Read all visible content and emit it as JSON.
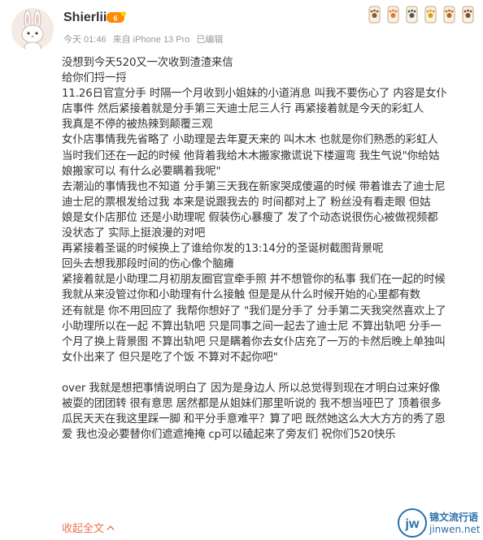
{
  "header": {
    "username": "Shierlii",
    "meta": {
      "time": "今天 01:46",
      "source": "来自 iPhone 13 Pro",
      "edited": "已编辑"
    },
    "vip_icon": "vip-badge-icon",
    "badge_icons": [
      "paw-badge-icon",
      "paw-badge-icon",
      "paw-badge-icon",
      "paw-badge-icon",
      "paw-badge-icon",
      "paw-badge-icon"
    ]
  },
  "post": {
    "lines": [
      "没想到今天520又一次收到渣渣来信",
      "给你们捋一捋",
      "11.26日官宣分手 时隔一个月收到小姐妹的小道消息 叫我不要伤心了 内容是女仆",
      "店事件 然后紧接着就是分手第三天迪士尼三人行 再紧接着就是今天的彩虹人",
      "我真是不停的被热辣到颠覆三观",
      "女仆店事情我先省略了 小助理是去年夏天来的 叫木木 也就是你们熟悉的彩虹人",
      "当时我们还在一起的时候 他背着我给木木搬家撒谎说下楼遛弯 我生气说\"你给姑",
      "娘搬家可以 有什么必要瞒着我呢\"",
      "去潮汕的事情我也不知道 分手第三天我在新家哭成傻逼的时候 带着谁去了迪士尼",
      " 迪士尼的票根发给过我 本来是说跟我去的 时间都对上了 粉丝没有看走眼 但姑",
      "娘是女仆店那位 还是小助理呢 假装伤心暴瘦了 发了个动态说很伤心被做视频都",
      "没状态了 实际上挺浪漫的对吧",
      "再紧接着圣诞的时候换上了谁给你发的13:14分的圣诞树截图背景呢",
      "回头去想我那段时间的伤心像个脑瘫",
      "紧接着就是小助理二月初朋友圈官宣牵手照 并不想管你的私事 我们在一起的时候",
      "我就从来没管过你和小助理有什么接触 但是是从什么时候开始的心里都有数",
      "还有就是 你不用回应了 我帮你想好了 \"我们是分手了 分手第二天我突然喜欢上了",
      "小助理所以在一起 不算出轨吧 只是同事之间一起去了迪士尼 不算出轨吧 分手一",
      "个月了换上背景图 不算出轨吧 只是瞒着你去女仆店充了一万的卡然后晚上单独叫",
      "女仆出来了 但只是吃了个饭 不算对不起你吧\"",
      "",
      "over 我就是想把事情说明白了 因为是身边人 所以总觉得到现在才明白过来好像",
      "被耍的团团转 很有意思 居然都是从姐妹们那里听说的 我不想当哑巴了 顶着很多",
      "瓜民天天在我这里踩一脚 和平分手意难平？算了吧 既然她这么大大方方的秀了恩",
      "爱 我也没必要替你们遮遮掩掩 cp可以磕起来了旁友们 祝你们520快乐"
    ],
    "collapse_label": "收起全文",
    "collapse_icon": "chevron-up-icon"
  },
  "watermark": {
    "logo_text": "jw",
    "line1": "锦文流行语",
    "line2": "jinwen.net"
  }
}
